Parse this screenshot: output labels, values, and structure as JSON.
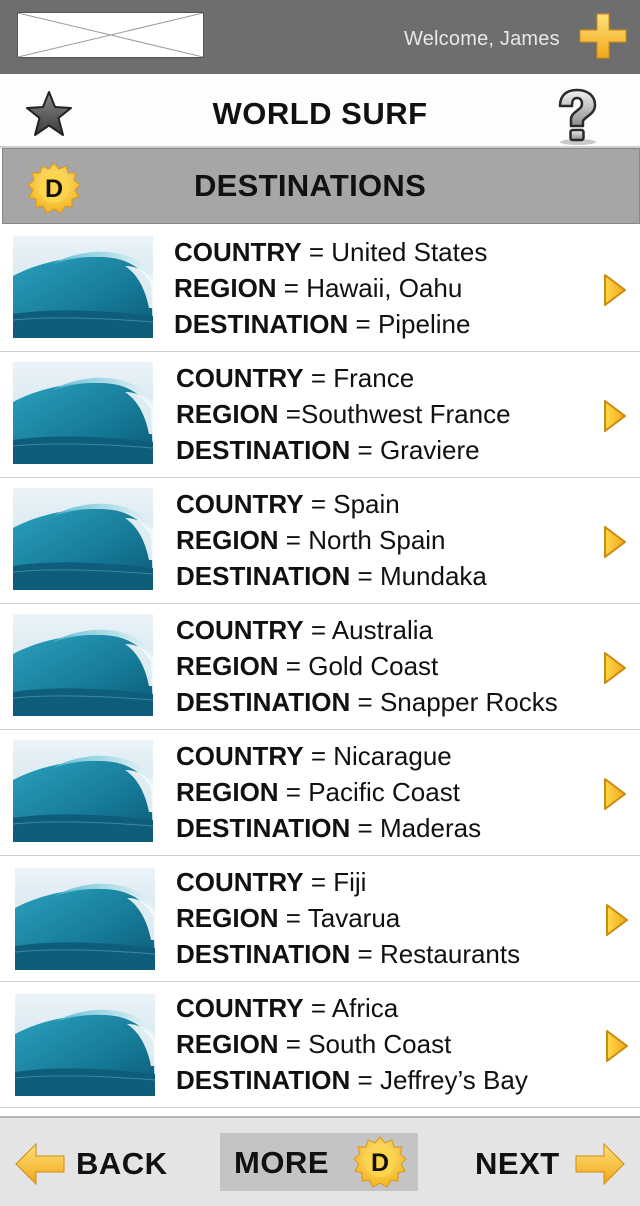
{
  "header": {
    "welcome_text": "Welcome,  James",
    "add_icon": "plus-icon"
  },
  "title_bar": {
    "title": "WORLD SURF",
    "favorite_icon": "star-icon",
    "help_icon": "question-icon"
  },
  "section": {
    "badge_letter": "D",
    "title": "DESTINATIONS"
  },
  "labels": {
    "country": "COUNTRY",
    "region": "REGION",
    "destination": "DESTINATION"
  },
  "destinations": [
    {
      "country_sep": " = ",
      "country": "United States",
      "region_sep": " = ",
      "region": "Hawaii, Oahu",
      "dest_sep": " = ",
      "destination": "Pipeline"
    },
    {
      "country_sep": " = ",
      "country": "France",
      "region_sep": " =",
      "region": "Southwest France",
      "dest_sep": " = ",
      "destination": "Graviere"
    },
    {
      "country_sep": " = ",
      "country": "Spain",
      "region_sep": " = ",
      "region": "North Spain",
      "dest_sep": " = ",
      "destination": "Mundaka"
    },
    {
      "country_sep": " = ",
      "country": "Australia",
      "region_sep": " = ",
      "region": "Gold Coast",
      "dest_sep": " = ",
      "destination": "Snapper Rocks"
    },
    {
      "country_sep": " = ",
      "country": "Nicarague",
      "region_sep": " = ",
      "region": "Pacific Coast",
      "dest_sep": " = ",
      "destination": "Maderas"
    },
    {
      "country_sep": " = ",
      "country": "Fiji",
      "region_sep": " = ",
      "region": "Tavarua",
      "dest_sep": " = ",
      "destination": "Restaurants"
    },
    {
      "country_sep": " = ",
      "country": "Africa",
      "region_sep": " = ",
      "region": "South Coast",
      "dest_sep": " = ",
      "destination": "Jeffrey’s Bay"
    }
  ],
  "footer": {
    "back_label": "BACK",
    "more_label": "MORE",
    "more_badge_letter": "D",
    "next_label": "NEXT"
  },
  "colors": {
    "top_bar": "#6e6e6e",
    "section_bar": "#a6a6a6",
    "accent_yellow": "#f7c52a",
    "wave_blue": "#1d8aa8"
  }
}
